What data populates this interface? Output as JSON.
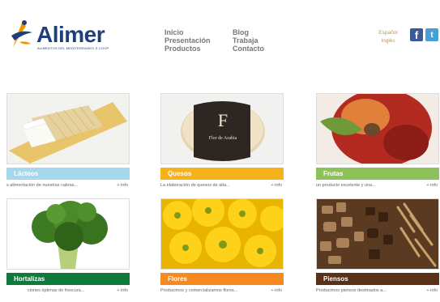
{
  "brand": {
    "name": "Alimer",
    "tagline": "ALIMENTOS DEL MEDITERRANEO S.COOP",
    "colors": {
      "blue": "#1f3f7a",
      "orange": "#f29400"
    }
  },
  "nav": {
    "col1": [
      "Inicio",
      "Presentación",
      "Productos"
    ],
    "col2": [
      "Blog",
      "Trabaja",
      "Contacto"
    ]
  },
  "languages": [
    "Español",
    "Inglés"
  ],
  "social": {
    "facebook": "f",
    "twitter": "t"
  },
  "products": [
    {
      "title": "Lácteos",
      "desc": "s alimentación de nuestras cabras...",
      "more": "+ info",
      "color": "#a6d8ed"
    },
    {
      "title": "Quesos",
      "desc": "La elaboración de quesos de alta...",
      "more": "+ info",
      "color": "#f5b21b"
    },
    {
      "title": "Frutas",
      "desc": "un producto excelente y una...",
      "more": "+ info",
      "color": "#8dc15a"
    },
    {
      "title": "Hortalizas",
      "desc": "ciones óptimas de frescura...",
      "more": "+ info",
      "color": "#0f7a3c"
    },
    {
      "title": "Flores",
      "desc": "Producimos y comercializamos flores...",
      "more": "+ info",
      "color": "#f6891f"
    },
    {
      "title": "Piensos",
      "desc": "Producimos piensos destinados a...",
      "more": "+ info",
      "color": "#5a3016"
    }
  ],
  "cheese_label": {
    "letter": "F",
    "text": "Flor de Arabia"
  }
}
